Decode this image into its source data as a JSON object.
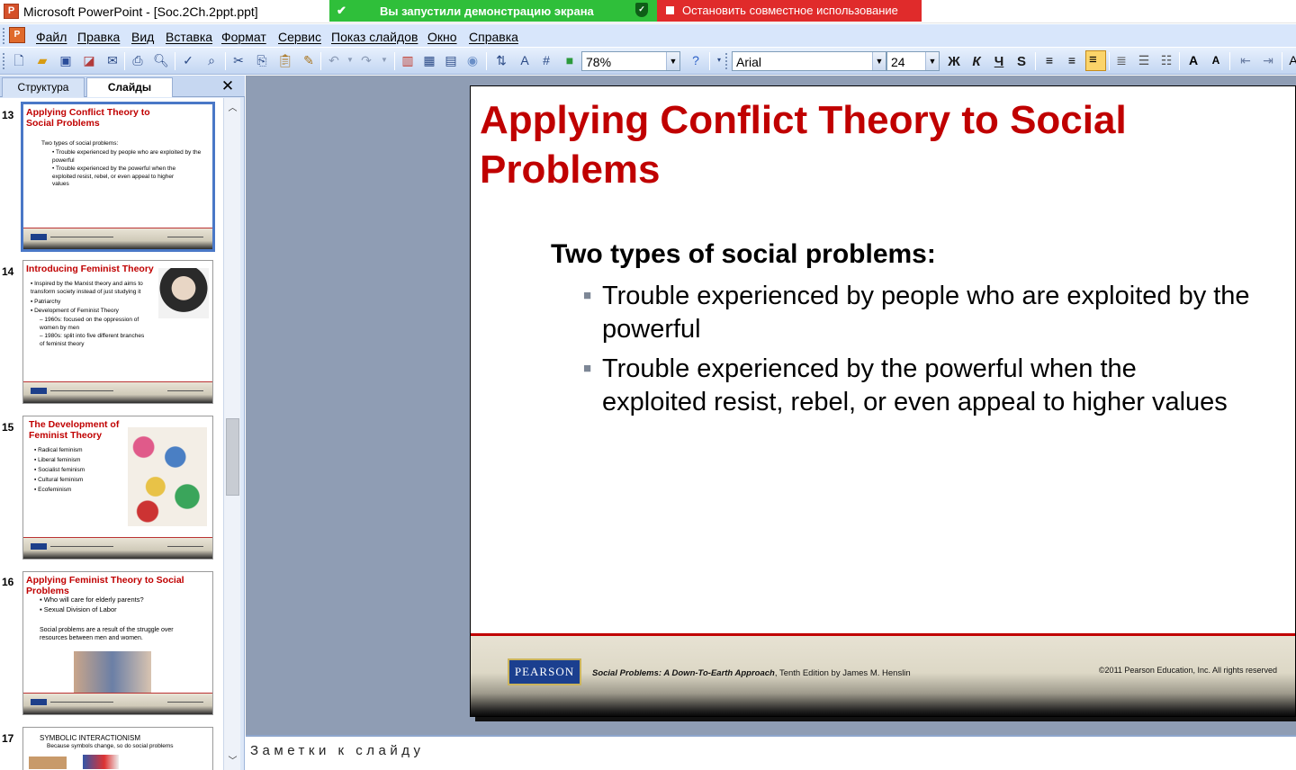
{
  "window": {
    "title": "Microsoft PowerPoint - [Soc.2Ch.2ppt.ppt]"
  },
  "share": {
    "status": "Вы запустили демонстрацию экрана",
    "stop_label": "Остановить совместное использование"
  },
  "menu": [
    "Файл",
    "Правка",
    "Вид",
    "Вставка",
    "Формат",
    "Сервис",
    "Показ слайдов",
    "Окно",
    "Справка"
  ],
  "toolbar": {
    "zoom": "78%",
    "font": "Arial",
    "font_size": "24",
    "bold": "Ж",
    "italic": "К",
    "underline": "Ч",
    "shadow": "S"
  },
  "panel": {
    "tab_outline": "Структура",
    "tab_slides": "Слайды",
    "close": "✕"
  },
  "thumbnails": [
    {
      "num": "13",
      "title": "Applying Conflict Theory to Social Problems",
      "lines": [
        "Two types of social problems:",
        "• Trouble experienced by people who are exploited by the powerful",
        "• Trouble experienced by the powerful when the exploited resist, rebel, or even appeal to higher values"
      ]
    },
    {
      "num": "14",
      "title": "Introducing Feminist Theory",
      "lines": [
        "▪ Inspired by the Marxist theory and aims to transform society instead of just studying it",
        "▪ Patriarchy",
        "▪ Development of Feminist Theory",
        "– 1960s: focused on the oppression of women by men",
        "– 1980s: split into five different branches of feminist theory"
      ]
    },
    {
      "num": "15",
      "title": "The Development of Feminist Theory",
      "lines": [
        "▪ Radical feminism",
        "▪ Liberal feminism",
        "▪ Socialist feminism",
        "▪ Cultural feminism",
        "▪ Ecofeminism"
      ]
    },
    {
      "num": "16",
      "title": "Applying Feminist Theory to Social Problems",
      "lines": [
        "▪ Who will care for elderly parents?",
        "▪ Sexual Division of Labor",
        "Social problems are a result of the struggle over resources between men and women."
      ]
    },
    {
      "num": "17",
      "title": "SYMBOLIC INTERACTIONISM",
      "lines": [
        "Because symbols change, so do social problems"
      ]
    }
  ],
  "slide": {
    "title": "Applying Conflict Theory to Social Problems",
    "heading": "Two types of social problems:",
    "bullets": [
      "Trouble experienced by people who are exploited by the powerful",
      "Trouble experienced by the powerful when the exploited resist, rebel, or even appeal to higher values"
    ],
    "publisher": "PEARSON",
    "footer_book": "Social Problems: A Down-To-Earth Approach",
    "footer_edition": ", Tenth Edition by James M. Henslin",
    "footer_copyright": "©2011 Pearson Education, Inc.  All rights reserved"
  },
  "notes": {
    "placeholder": "Заметки к слайду"
  },
  "colors": {
    "title_red": "#c00000",
    "share_green": "#2fbf3a",
    "stop_red": "#e02b2b",
    "pearson_blue": "#1b3f8f"
  }
}
